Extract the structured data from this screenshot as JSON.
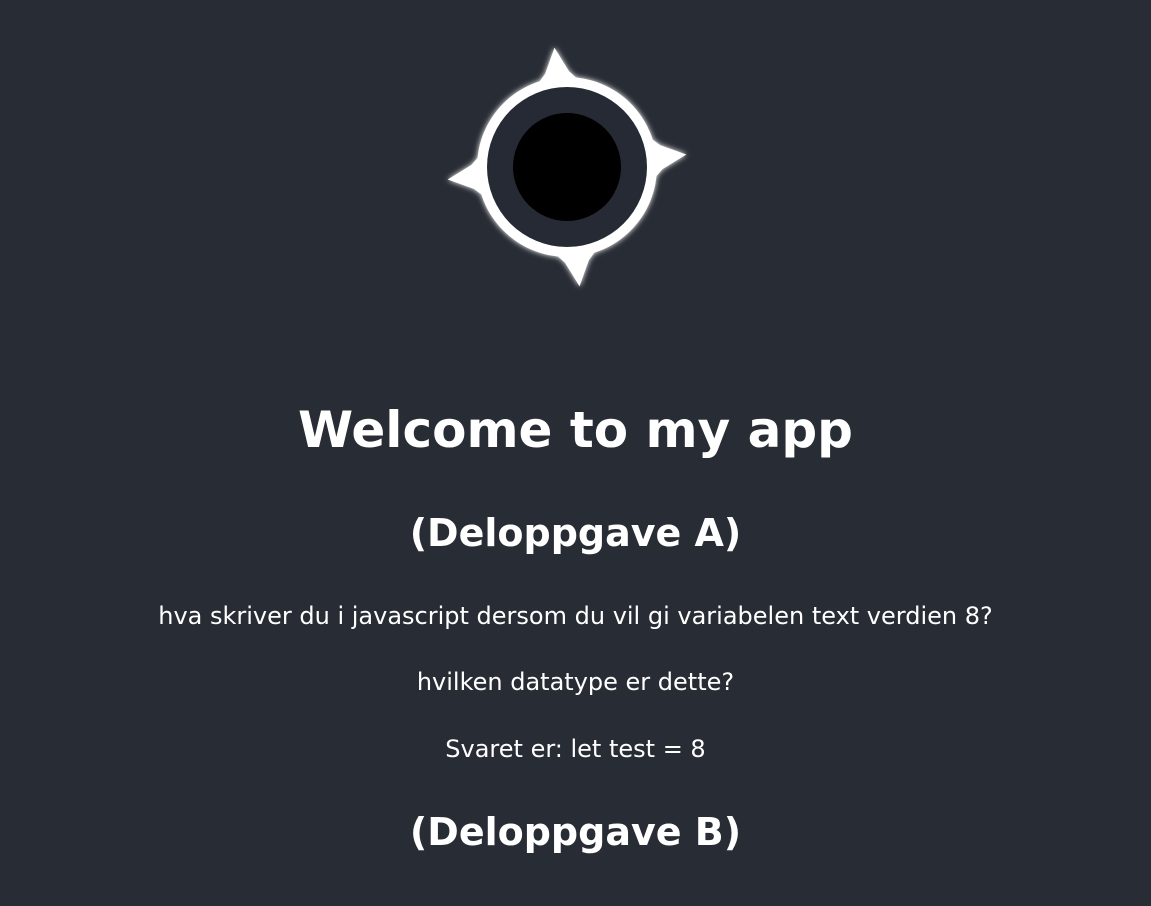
{
  "logo": {
    "icon": "compass-icon",
    "ring_color": "#ffffff",
    "center_color": "#000000",
    "glow_color": "#ffffff"
  },
  "header": {
    "title": "Welcome to my app"
  },
  "section_a": {
    "heading": "(Deloppgave A)",
    "question_1": "hva skriver du i javascript dersom du vil gi variabelen text verdien 8?",
    "question_2": "hvilken datatype er dette?",
    "answer": "Svaret er: let test = 8"
  },
  "section_b": {
    "heading": "(Deloppgave B)"
  },
  "theme": {
    "background": "#282c34",
    "text": "#ffffff"
  }
}
